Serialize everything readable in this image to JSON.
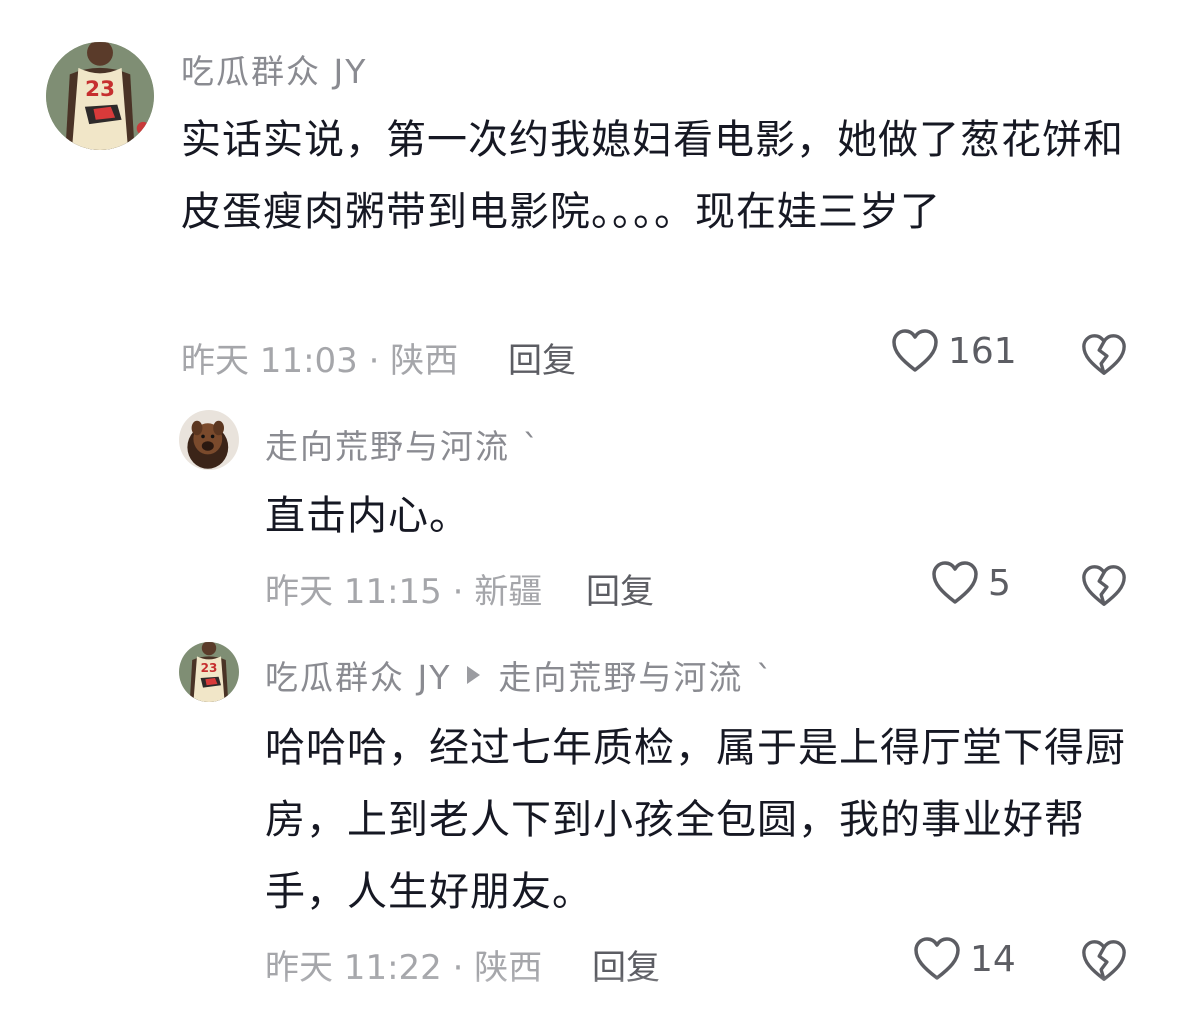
{
  "comments": [
    {
      "username": "吃瓜群众 JY",
      "text": "实话实说，第一次约我媳妇看电影，她做了葱花饼和皮蛋瘦肉粥带到电影院。。。。现在娃三岁了",
      "time_location": "昨天 11:03 · 陕西",
      "reply_label": "回复",
      "likes": "161",
      "avatar_icon": "jersey-23-avatar"
    },
    {
      "username": "走向荒野与河流 `",
      "text": "直击内心。",
      "time_location": "昨天 11:15 · 新疆",
      "reply_label": "回复",
      "likes": "5",
      "avatar_icon": "dog-avatar"
    },
    {
      "username": "吃瓜群众 JY",
      "reply_to": "走向荒野与河流 `",
      "text": "哈哈哈，经过七年质检，属于是上得厅堂下得厨房，上到老人下到小孩全包圆，我的事业好帮手，人生好朋友。",
      "time_location": "昨天 11:22 · 陕西",
      "reply_label": "回复",
      "likes": "14",
      "avatar_icon": "jersey-23-avatar"
    }
  ],
  "colors": {
    "username": "#8a8b91",
    "text": "#161823",
    "meta": "#a5a6aa",
    "action": "#5c5d63"
  }
}
